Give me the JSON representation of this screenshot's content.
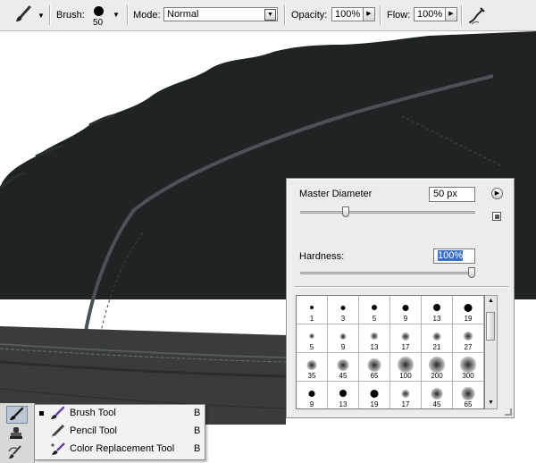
{
  "options_bar": {
    "tool_icon": "brush-icon",
    "brush_label": "Brush:",
    "brush_size": "50",
    "mode_label": "Mode:",
    "mode_value": "Normal",
    "opacity_label": "Opacity:",
    "opacity_value": "100%",
    "flow_label": "Flow:",
    "flow_value": "100%",
    "airbrush_icon": "airbrush-icon"
  },
  "brush_panel": {
    "master_diameter_label": "Master Diameter",
    "master_diameter_value": "50 px",
    "master_diameter_slider_fraction": 0.25,
    "hardness_label": "Hardness:",
    "hardness_value": "100%",
    "hardness_slider_fraction": 1.0,
    "menu_icon": "panel-menu-arrow-icon",
    "new_preset_icon": "new-preset-icon",
    "presets": [
      {
        "size": 1,
        "soft": false
      },
      {
        "size": 3,
        "soft": false
      },
      {
        "size": 5,
        "soft": false
      },
      {
        "size": 9,
        "soft": false
      },
      {
        "size": 13,
        "soft": false
      },
      {
        "size": 19,
        "soft": false
      },
      {
        "size": 5,
        "soft": true
      },
      {
        "size": 9,
        "soft": true
      },
      {
        "size": 13,
        "soft": true
      },
      {
        "size": 17,
        "soft": true
      },
      {
        "size": 21,
        "soft": true
      },
      {
        "size": 27,
        "soft": true
      },
      {
        "size": 35,
        "soft": true
      },
      {
        "size": 45,
        "soft": true
      },
      {
        "size": 65,
        "soft": true
      },
      {
        "size": 100,
        "soft": true
      },
      {
        "size": 200,
        "soft": true
      },
      {
        "size": 300,
        "soft": true
      },
      {
        "size": 9,
        "soft": false
      },
      {
        "size": 13,
        "soft": false
      },
      {
        "size": 19,
        "soft": false
      },
      {
        "size": 17,
        "soft": true
      },
      {
        "size": 45,
        "soft": true
      },
      {
        "size": 65,
        "soft": true
      }
    ]
  },
  "tool_flyout": {
    "items": [
      {
        "label": "Brush Tool",
        "shortcut": "B",
        "icon": "brush-tool-icon",
        "active": true
      },
      {
        "label": "Pencil Tool",
        "shortcut": "B",
        "icon": "pencil-tool-icon",
        "active": false
      },
      {
        "label": "Color Replacement Tool",
        "shortcut": "B",
        "icon": "color-replacement-tool-icon",
        "active": false
      }
    ]
  },
  "colors": {
    "shoe_body": "#1f2323",
    "shoe_stripe": "#4a5256",
    "sole": "#3a3c3c",
    "selection_highlight": "#3a6fc9"
  }
}
